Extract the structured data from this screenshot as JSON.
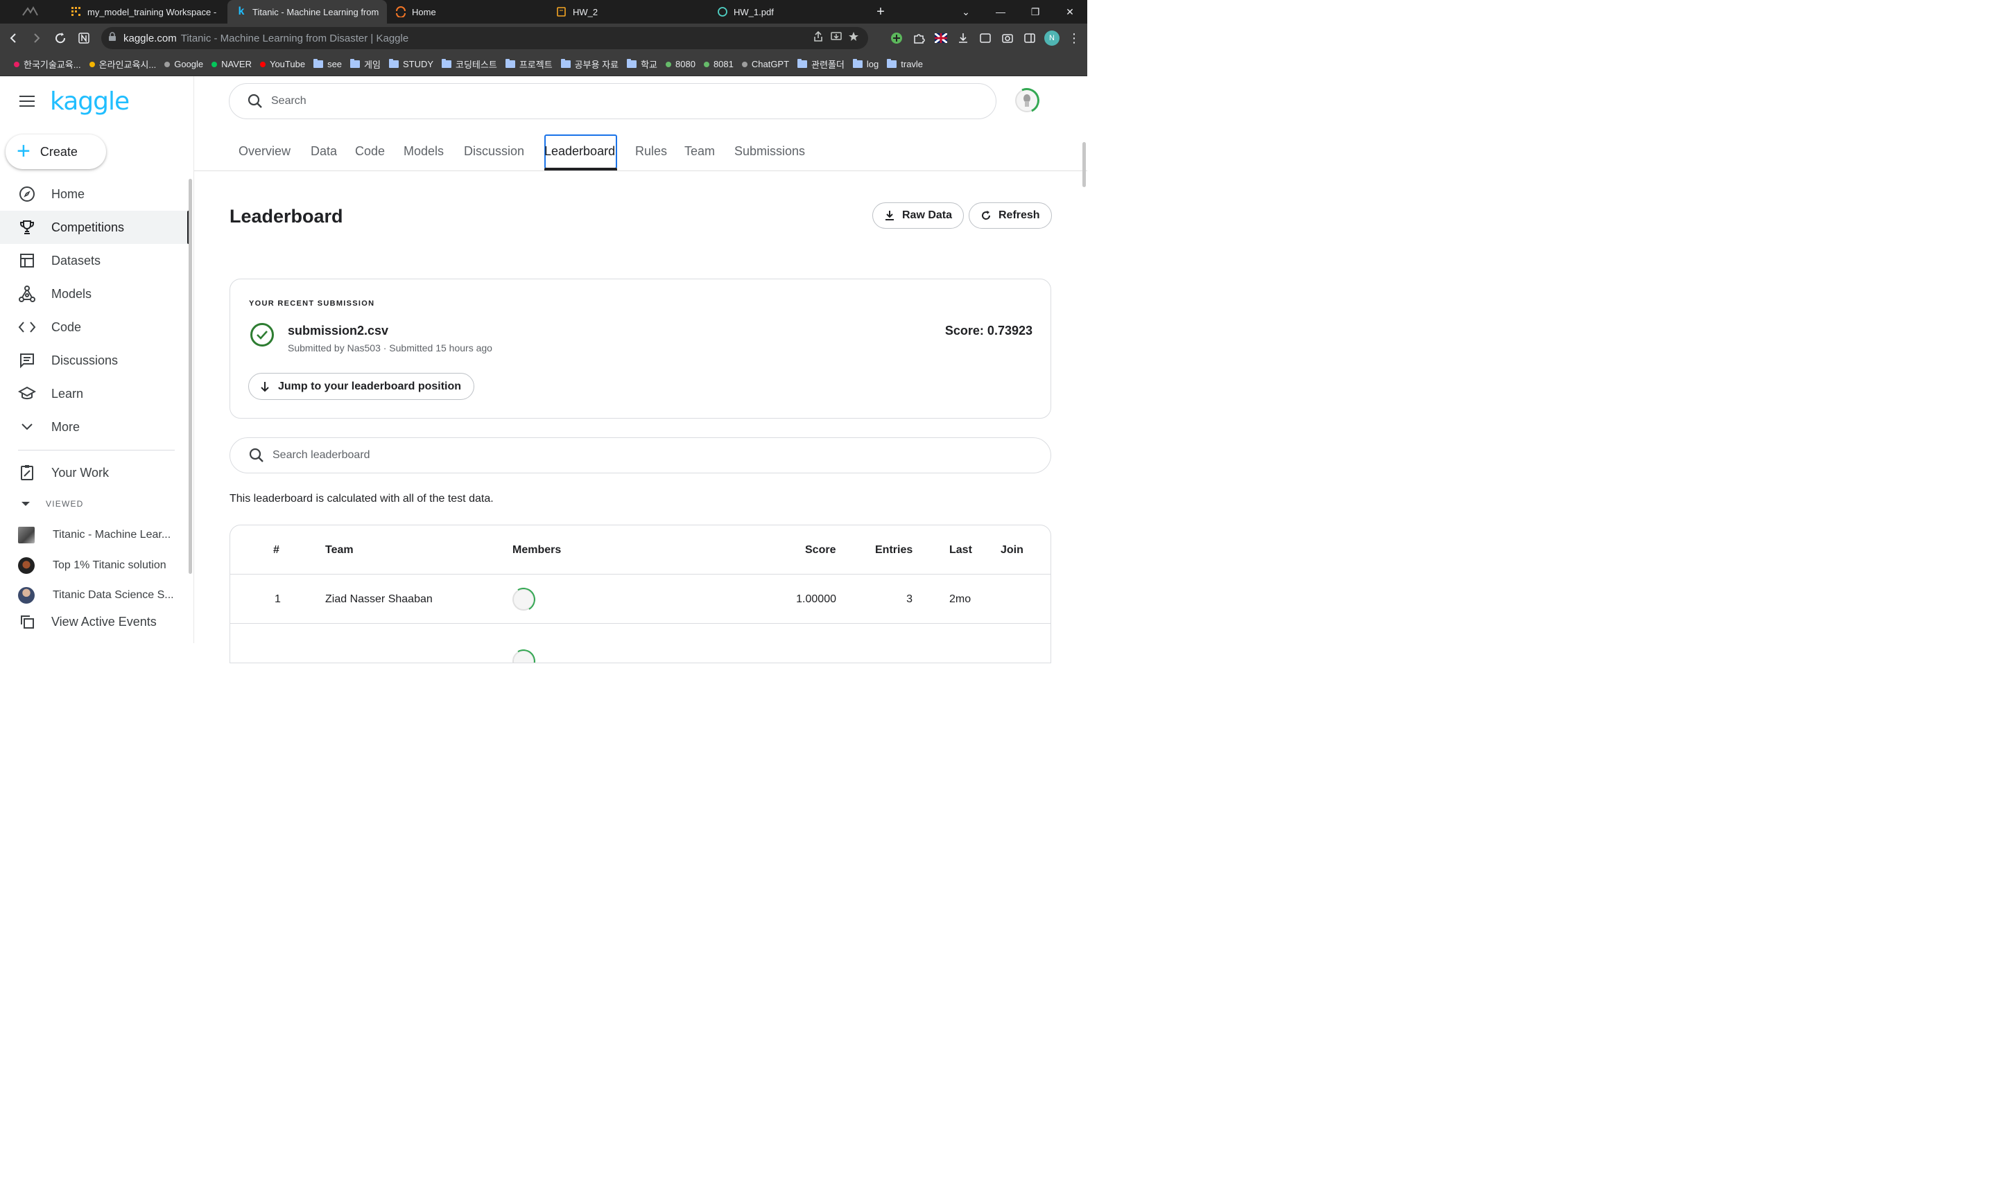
{
  "browser": {
    "tabs": [
      {
        "title": "my_model_training Workspace -",
        "active": false
      },
      {
        "title": "Titanic - Machine Learning from",
        "active": true
      },
      {
        "title": "Home",
        "active": false
      },
      {
        "title": "HW_2",
        "active": false
      },
      {
        "title": "HW_1.pdf",
        "active": false
      }
    ],
    "url_host": "kaggle.com",
    "url_rest": "Titanic - Machine Learning from Disaster | Kaggle",
    "profile_initial": "N",
    "bookmarks": [
      {
        "label": "한국기술교육...",
        "kind": "dot",
        "color": "#e91e63"
      },
      {
        "label": "온라인교육시...",
        "kind": "dot",
        "color": "#f4b400"
      },
      {
        "label": "Google",
        "kind": "dot",
        "color": "#9e9e9e"
      },
      {
        "label": "NAVER",
        "kind": "dot",
        "color": "#03c75a"
      },
      {
        "label": "YouTube",
        "kind": "dot",
        "color": "#ff0000"
      },
      {
        "label": "see",
        "kind": "folder"
      },
      {
        "label": "게임",
        "kind": "folder"
      },
      {
        "label": "STUDY",
        "kind": "folder"
      },
      {
        "label": "코딩테스트",
        "kind": "folder"
      },
      {
        "label": "프로젝트",
        "kind": "folder"
      },
      {
        "label": "공부용 자료",
        "kind": "folder"
      },
      {
        "label": "학교",
        "kind": "folder"
      },
      {
        "label": "8080",
        "kind": "dot",
        "color": "#66bb6a"
      },
      {
        "label": "8081",
        "kind": "dot",
        "color": "#66bb6a"
      },
      {
        "label": "ChatGPT",
        "kind": "dot",
        "color": "#9e9e9e"
      },
      {
        "label": "관련폴더",
        "kind": "folder"
      },
      {
        "label": "log",
        "kind": "folder"
      },
      {
        "label": "travle",
        "kind": "folder"
      }
    ]
  },
  "sidebar": {
    "logo": "kaggle",
    "create_label": "Create",
    "items": [
      {
        "label": "Home",
        "icon": "compass-icon"
      },
      {
        "label": "Competitions",
        "icon": "trophy-icon",
        "active": true
      },
      {
        "label": "Datasets",
        "icon": "table-icon"
      },
      {
        "label": "Models",
        "icon": "models-icon"
      },
      {
        "label": "Code",
        "icon": "code-icon"
      },
      {
        "label": "Discussions",
        "icon": "discussion-icon"
      },
      {
        "label": "Learn",
        "icon": "graduation-cap-icon"
      },
      {
        "label": "More",
        "icon": "chevron-down-icon"
      }
    ],
    "your_work": "Your Work",
    "viewed_header": "VIEWED",
    "viewed": [
      {
        "label": "Titanic - Machine Lear..."
      },
      {
        "label": "Top 1% Titanic solution"
      },
      {
        "label": "Titanic Data Science S..."
      }
    ],
    "view_active_events": "View Active Events"
  },
  "main": {
    "search_placeholder": "Search",
    "tabs": [
      "Overview",
      "Data",
      "Code",
      "Models",
      "Discussion",
      "Leaderboard",
      "Rules",
      "Team",
      "Submissions"
    ],
    "active_tab": "Leaderboard",
    "title": "Leaderboard",
    "raw_data_label": "Raw Data",
    "refresh_label": "Refresh",
    "recent": {
      "label": "YOUR RECENT SUBMISSION",
      "filename": "submission2.csv",
      "meta": "Submitted by Nas503 · Submitted 15 hours ago",
      "score": "Score: 0.73923",
      "jump_label": "Jump to your leaderboard position"
    },
    "lb_search_placeholder": "Search leaderboard",
    "note": "This leaderboard is calculated with all of the test data.",
    "table": {
      "headers": {
        "rank": "#",
        "team": "Team",
        "members": "Members",
        "score": "Score",
        "entries": "Entries",
        "last": "Last",
        "join": "Join"
      },
      "rows": [
        {
          "rank": "1",
          "team": "Ziad Nasser Shaaban",
          "score": "1.00000",
          "entries": "3",
          "last": "2mo"
        }
      ]
    }
  }
}
